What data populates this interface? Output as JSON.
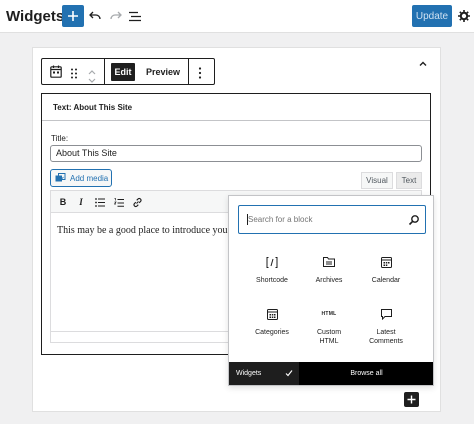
{
  "header": {
    "title": "Widgets",
    "update_label": "Update",
    "icons": [
      "plus-icon",
      "undo-icon",
      "redo-icon",
      "list-view-icon",
      "gear-icon"
    ]
  },
  "toolbar": {
    "edit_label": "Edit",
    "preview_label": "Preview"
  },
  "widget": {
    "heading": "Text: About This Site",
    "title_label": "Title:",
    "title_value": "About This Site",
    "add_media_label": "Add media",
    "tab_visual": "Visual",
    "tab_text": "Text",
    "content": "This may be a good place to introduce you"
  },
  "inserter": {
    "search_placeholder": "Search for a block",
    "blocks": [
      {
        "label": "Shortcode",
        "icon": "shortcode-icon"
      },
      {
        "label": "Archives",
        "icon": "archives-icon"
      },
      {
        "label": "Calendar",
        "icon": "calendar-icon"
      },
      {
        "label": "Categories",
        "icon": "categories-icon"
      },
      {
        "label": "Custom HTML",
        "icon": "html-icon"
      },
      {
        "label": "Latest Comments",
        "icon": "comments-icon"
      }
    ],
    "footer_widgets": "Widgets",
    "footer_browse": "Browse all"
  },
  "colors": {
    "accent": "#2271b1",
    "dark": "#1e1e1e",
    "background": "#f0f0f1"
  }
}
